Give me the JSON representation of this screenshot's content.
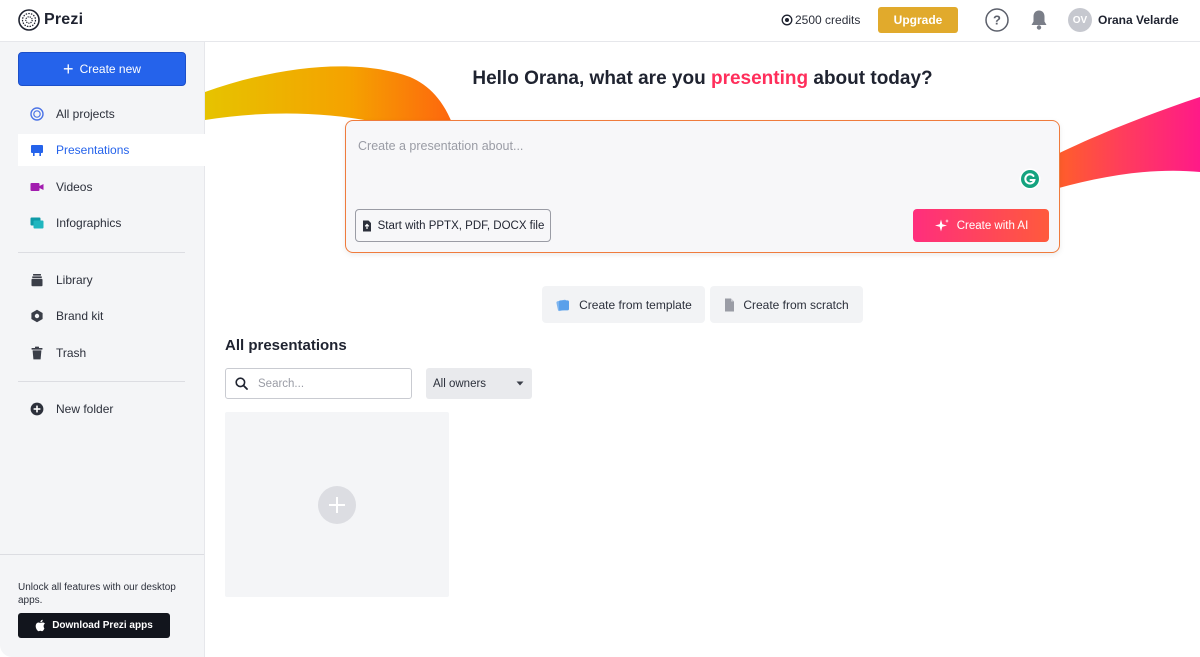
{
  "app": {
    "name": "Prezi"
  },
  "header": {
    "credits": "2500 credits",
    "upgrade_label": "Upgrade",
    "user": {
      "initials": "OV",
      "name": "Orana Velarde"
    }
  },
  "sidebar": {
    "create_new_label": "Create new",
    "items": [
      {
        "label": "All projects",
        "icon": "projects-icon"
      },
      {
        "label": "Presentations",
        "icon": "presentation-icon",
        "active": true
      },
      {
        "label": "Videos",
        "icon": "video-icon"
      },
      {
        "label": "Infographics",
        "icon": "infographic-icon"
      },
      {
        "label": "Library",
        "icon": "library-icon"
      },
      {
        "label": "Brand kit",
        "icon": "brand-kit-icon"
      },
      {
        "label": "Trash",
        "icon": "trash-icon"
      },
      {
        "label": "New folder",
        "icon": "add-folder-icon"
      }
    ],
    "footer": {
      "message": "Unlock all features with our desktop apps.",
      "download_label": "Download Prezi apps"
    }
  },
  "main": {
    "greeting": {
      "before": "Hello Orana, what are you ",
      "highlight": "presenting",
      "after": " about today?"
    },
    "prompt": {
      "placeholder": "Create a presentation about...",
      "value": "",
      "file_button_label": "Start with PPTX, PDF, DOCX file",
      "ai_button_label": "Create with AI"
    },
    "template_button_label": "Create from template",
    "scratch_button_label": "Create from scratch",
    "section_title": "All presentations",
    "search": {
      "placeholder": "Search...",
      "value": ""
    },
    "owners_filter": {
      "selected": "All owners"
    }
  },
  "colors": {
    "accent_blue": "#2563eb",
    "upgrade_gold": "#e1aa2c",
    "highlight_pink": "#ff2e5b",
    "ai_gradient_start": "#ff2e7d",
    "ai_gradient_end": "#ff5a3c"
  }
}
